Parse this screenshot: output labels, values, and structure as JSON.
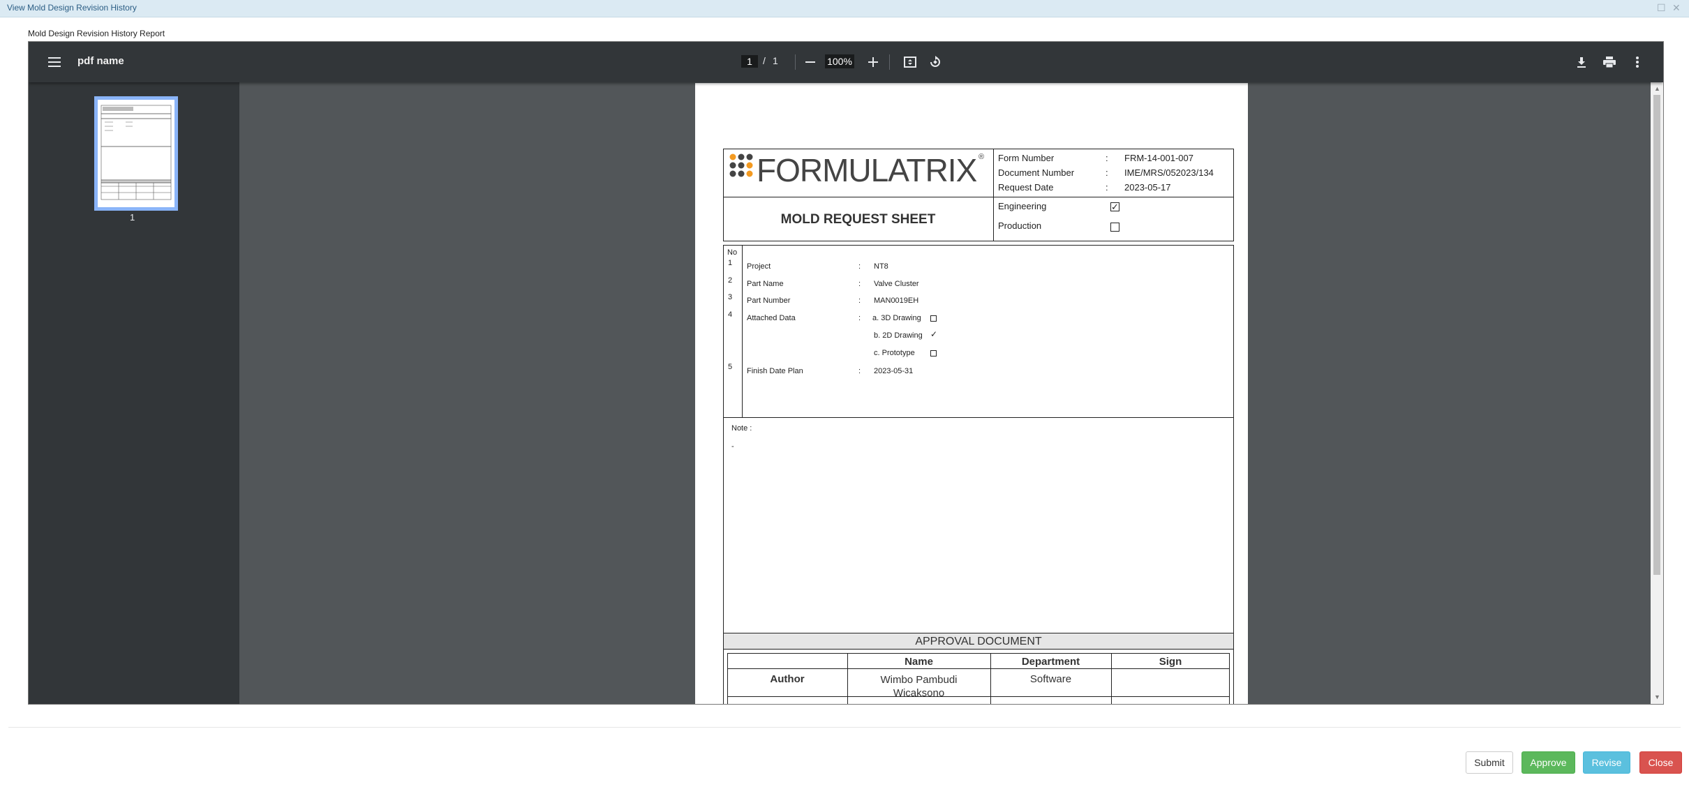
{
  "window": {
    "title": "View Mold Design Revision History"
  },
  "report_label": "Mold Design Revision History Report",
  "viewer": {
    "pdf_name": "pdf name",
    "current_page": "1",
    "page_sep": "/",
    "total_pages": "1",
    "zoom": "100%",
    "thumbnail_page": "1"
  },
  "document": {
    "brand": "FORMULATRIX",
    "brand_reg": "®",
    "header_fields": [
      {
        "label": "Form Number",
        "sep": ":",
        "value": "FRM-14-001-007"
      },
      {
        "label": "Document Number",
        "sep": ":",
        "value": "IME/MRS/052023/134"
      },
      {
        "label": "Request Date",
        "sep": ":",
        "value": "2023-05-17"
      }
    ],
    "sheet_title": "MOLD REQUEST SHEET",
    "types": [
      {
        "label": "Engineering",
        "mark": "✓"
      },
      {
        "label": "Production",
        "mark": ""
      }
    ],
    "no_header": "No",
    "rows": [
      {
        "no": "1",
        "label": "Project",
        "sep": ":",
        "value": "NT8"
      },
      {
        "no": "2",
        "label": "Part Name",
        "sep": ":",
        "value": "Valve Cluster"
      },
      {
        "no": "3",
        "label": "Part Number",
        "sep": ":",
        "value": "MAN0019EH"
      },
      {
        "no": "4",
        "label": "Attached Data",
        "sep": ":",
        "value": ""
      },
      {
        "no": "5",
        "label": "Finish Date Plan",
        "sep": ":",
        "value": "2023-05-31"
      }
    ],
    "attached": [
      {
        "label": "a. 3D Drawing",
        "mark": ""
      },
      {
        "label": "b. 2D Drawing",
        "mark": "✓"
      },
      {
        "label": "c. Prototype",
        "mark": ""
      }
    ],
    "note_label": "Note :",
    "note_value": "-",
    "approval_title": "APPROVAL DOCUMENT",
    "approval_headers": [
      "Name",
      "Department",
      "Sign"
    ],
    "approval_row": {
      "role": "Author",
      "name": "Wimbo Pambudi Wicaksono",
      "department": "Software",
      "sign": ""
    }
  },
  "buttons": {
    "submit": "Submit",
    "approve": "Approve",
    "revise": "Revise",
    "close": "Close"
  },
  "colors": {
    "approve": "#5cb85c",
    "revise": "#5bc0de",
    "close": "#d9534f",
    "titlebar": "#dbeaf3"
  }
}
